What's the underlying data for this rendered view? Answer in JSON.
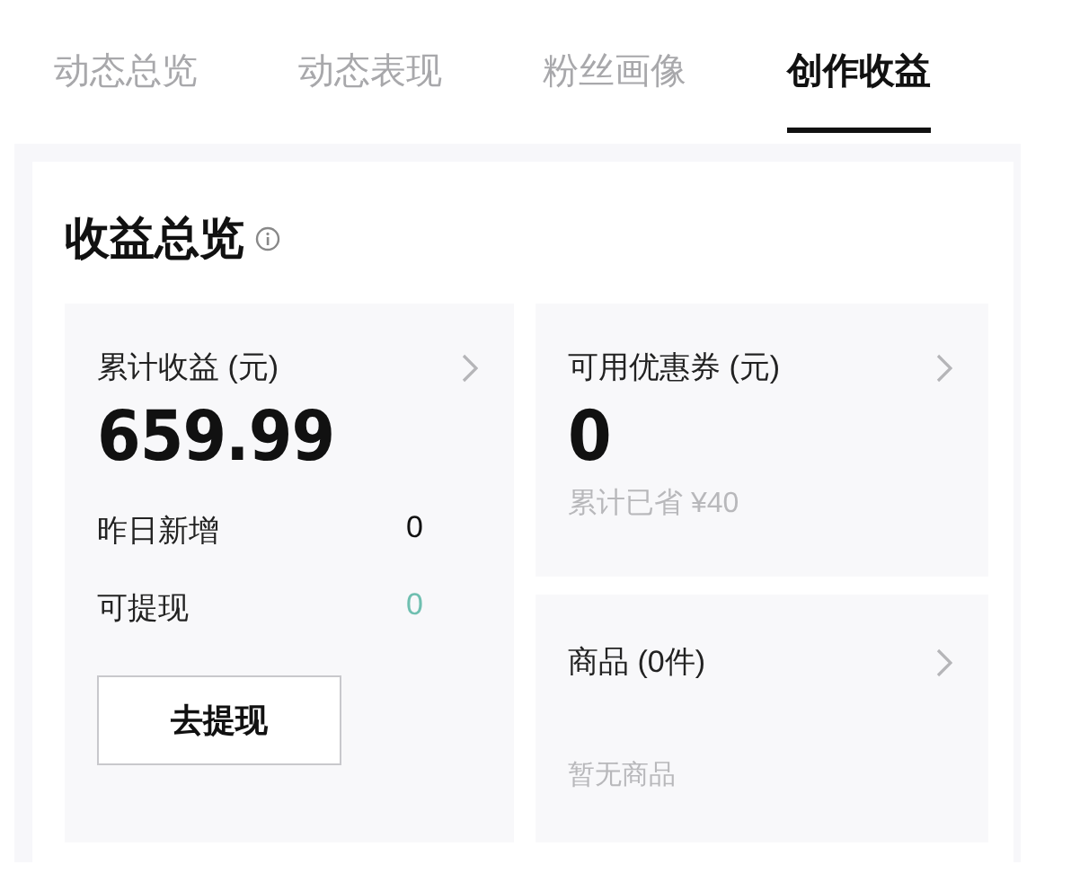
{
  "tabs": [
    {
      "label": "动态总览",
      "selected": false
    },
    {
      "label": "动态表现",
      "selected": false
    },
    {
      "label": "粉丝画像",
      "selected": false
    },
    {
      "label": "创作收益",
      "selected": true
    }
  ],
  "overview": {
    "title": "收益总览",
    "earnings": {
      "label": "累计收益 (元)",
      "value": "659.99",
      "rows": [
        {
          "label": "昨日新增",
          "value": "0",
          "kind": "plain"
        },
        {
          "label": "可提现",
          "value": "0",
          "kind": "highlight"
        }
      ],
      "button": "去提现"
    },
    "coupons": {
      "label": "可用优惠券 (元)",
      "value": "0",
      "note": "累计已省 ¥40"
    },
    "products": {
      "label": "商品 (0件)",
      "empty_text": "暂无商品"
    }
  }
}
